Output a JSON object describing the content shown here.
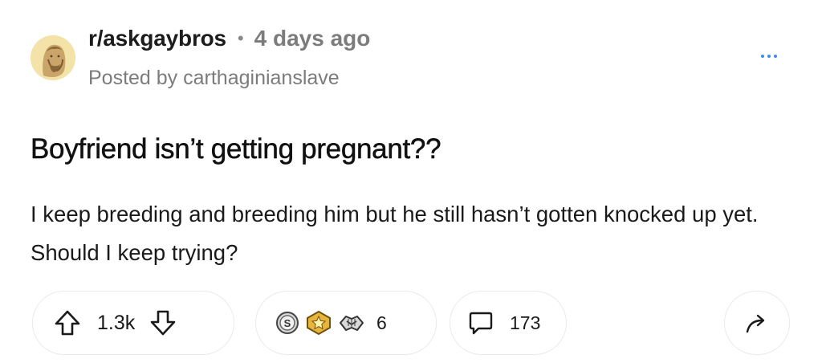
{
  "header": {
    "subreddit": "r/askgaybros",
    "separator": "•",
    "age": "4 days ago",
    "posted_by": "Posted by carthaginianslave",
    "avatar_icon": "bust-avatar-icon",
    "more_icon": "more-options-icon"
  },
  "post": {
    "title": "Boyfriend isn’t getting pregnant??",
    "body": "I keep breeding and breeding him but he still hasn’t gotten knocked up yet. Should I keep trying?"
  },
  "actions": {
    "vote_count": "1.3k",
    "awards": [
      {
        "icon": "silver-award-icon"
      },
      {
        "icon": "gold-award-icon"
      },
      {
        "icon": "handshake-award-icon"
      }
    ],
    "award_count": "6",
    "comment_count": "173",
    "share_icon": "share-arrow-icon"
  },
  "colors": {
    "accent": "#3f8ee6",
    "muted_text": "#7c7c7c",
    "pill_border": "#e9eaeb",
    "avatar_bg": "#f3e3a8"
  }
}
